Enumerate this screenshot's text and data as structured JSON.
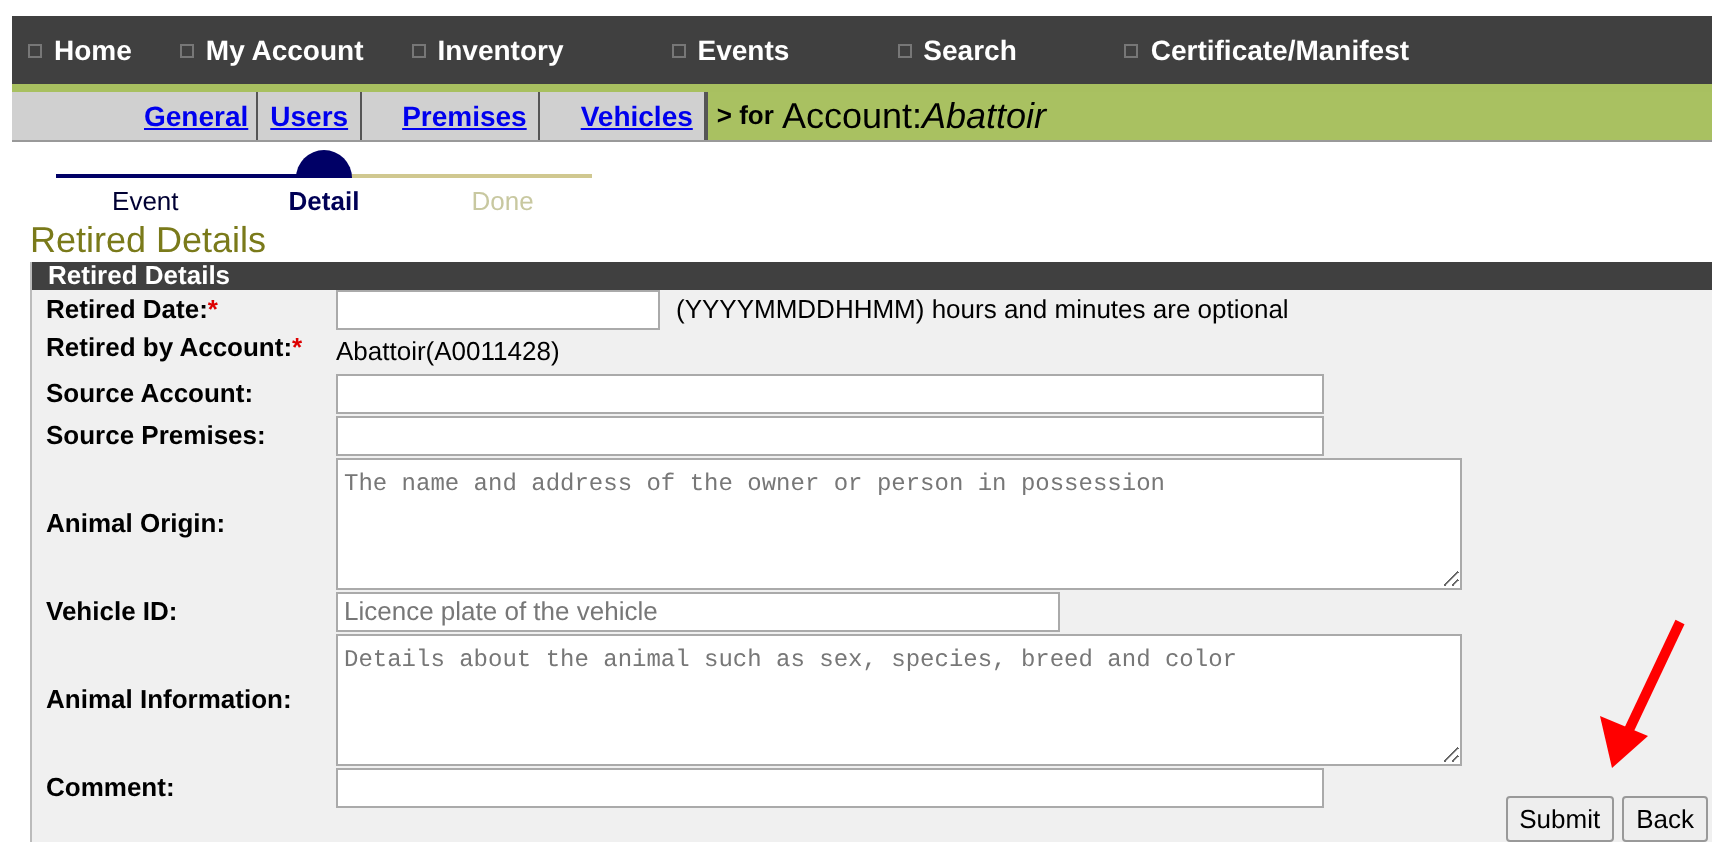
{
  "nav": [
    {
      "label": "Home"
    },
    {
      "label": "My Account"
    },
    {
      "label": "Inventory"
    },
    {
      "label": "Events"
    },
    {
      "label": "Search"
    },
    {
      "label": "Certificate/Manifest"
    }
  ],
  "subnav": {
    "tabs": [
      {
        "label": "General"
      },
      {
        "label": "Users"
      },
      {
        "label": "Premises"
      },
      {
        "label": "Vehicles"
      }
    ],
    "prefix": "> for",
    "context": "Account:*Abattoir*"
  },
  "steps": [
    {
      "label": "Event",
      "completed": true,
      "selected": false
    },
    {
      "label": "Detail",
      "completed": false,
      "selected": true
    },
    {
      "label": "Done",
      "completed": false,
      "selected": false
    }
  ],
  "page_title": "Retired Details",
  "section": {
    "title": "Retired Details",
    "fields": [
      {
        "kind": "date-input",
        "label": "Retired Date:",
        "required_mark": "*",
        "hint": "(YYYYMMDDHHMM) hours and minutes are optional"
      },
      {
        "kind": "static",
        "label": "Retired by Account:",
        "required_mark": "*",
        "value": "Abattoir(A0011428)"
      },
      {
        "kind": "text-input",
        "label": "Source Account:"
      },
      {
        "kind": "text-input",
        "label": "Source Premises:"
      },
      {
        "kind": "text-area",
        "label": "Animal Origin:",
        "placeholder": "The name and address of the owner or person in possession"
      },
      {
        "kind": "short-input",
        "label": "Vehicle ID:",
        "placeholder": "Licence plate of the vehicle"
      },
      {
        "kind": "text-area",
        "label": "Animal Information:",
        "placeholder": "Details about the animal such as sex, species, breed and color"
      },
      {
        "kind": "text-input",
        "label": "Comment:"
      }
    ]
  },
  "buttons": [
    "Submit",
    "Back"
  ]
}
